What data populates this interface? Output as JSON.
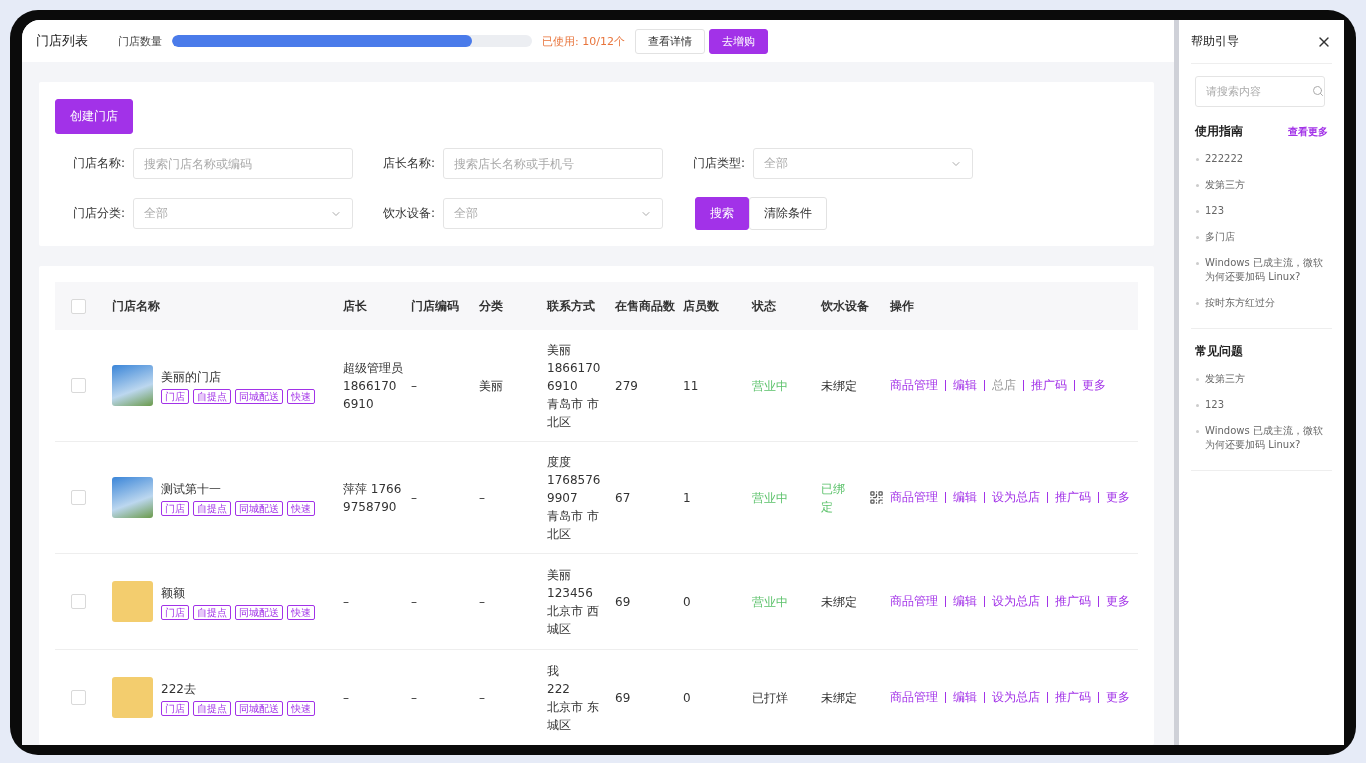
{
  "header": {
    "title": "门店列表",
    "quota_label": "门店数量",
    "quota": {
      "level": 0.833
    },
    "quota_text": "已使用: 10/12个",
    "buttons": [
      {
        "label": "查看详情",
        "kind": "default"
      },
      {
        "label": "去增购",
        "kind": "primary"
      }
    ]
  },
  "create_button": "创建门店",
  "filters": [
    {
      "label": "门店名称:",
      "kind": "input",
      "placeholder": "搜索门店名称或编码"
    },
    {
      "label": "店长名称:",
      "kind": "input",
      "placeholder": "搜索店长名称或手机号"
    },
    {
      "label": "门店类型:",
      "kind": "select",
      "value": "全部"
    },
    {
      "label": "门店分类:",
      "kind": "select",
      "value": "全部"
    },
    {
      "label": "饮水设备:",
      "kind": "select",
      "value": "全部"
    }
  ],
  "filter_buttons": [
    {
      "label": "搜索",
      "kind": "primary"
    },
    {
      "label": "清除条件",
      "kind": "default"
    }
  ],
  "table": {
    "columns": [
      "门店名称",
      "店长",
      "门店编码",
      "分类",
      "联系方式",
      "在售商品数",
      "店员数",
      "状态",
      "饮水设备",
      "操作"
    ],
    "select_all": false,
    "rows": [
      {
        "selected": false,
        "kind": "photo",
        "name": "美丽的门店",
        "tags": [
          "门店",
          "自提点",
          "同城配送",
          "快速"
        ],
        "manager": "超级管理员 18661706910",
        "code": "–",
        "category": "美丽",
        "contact": [
          "美丽",
          "18661706910",
          "青岛市 市北区"
        ],
        "goods": "279",
        "staff": "11",
        "status": {
          "text": "营业中",
          "kind": "open"
        },
        "device": {
          "text": "未绑定",
          "bound": false
        },
        "actions": [
          {
            "label": "商品管理",
            "disabled": false
          },
          {
            "label": "编辑",
            "disabled": false
          },
          {
            "label": "总店",
            "disabled": true
          },
          {
            "label": "推广码",
            "disabled": false
          },
          {
            "label": "更多",
            "disabled": false
          }
        ]
      },
      {
        "selected": false,
        "kind": "photo",
        "name": "测试第十一",
        "tags": [
          "门店",
          "自提点",
          "同城配送",
          "快速"
        ],
        "manager": "萍萍 17669758790",
        "code": "–",
        "category": "–",
        "contact": [
          "度度",
          "17685769907",
          "青岛市 市北区"
        ],
        "goods": "67",
        "staff": "1",
        "status": {
          "text": "营业中",
          "kind": "open"
        },
        "device": {
          "text": "已绑定",
          "bound": true
        },
        "actions": [
          {
            "label": "商品管理",
            "disabled": false
          },
          {
            "label": "编辑",
            "disabled": false
          },
          {
            "label": "设为总店",
            "disabled": false
          },
          {
            "label": "推广码",
            "disabled": false
          },
          {
            "label": "更多",
            "disabled": false
          }
        ]
      },
      {
        "selected": false,
        "kind": "placeholder",
        "name": "额额",
        "tags": [
          "门店",
          "自提点",
          "同城配送",
          "快速"
        ],
        "manager": "–",
        "code": "–",
        "category": "–",
        "contact": [
          "美丽",
          "123456",
          "北京市 西城区"
        ],
        "goods": "69",
        "staff": "0",
        "status": {
          "text": "营业中",
          "kind": "open"
        },
        "device": {
          "text": "未绑定",
          "bound": false
        },
        "actions": [
          {
            "label": "商品管理",
            "disabled": false
          },
          {
            "label": "编辑",
            "disabled": false
          },
          {
            "label": "设为总店",
            "disabled": false
          },
          {
            "label": "推广码",
            "disabled": false
          },
          {
            "label": "更多",
            "disabled": false
          }
        ]
      },
      {
        "selected": false,
        "kind": "placeholder",
        "name": "222去",
        "tags": [
          "门店",
          "自提点",
          "同城配送",
          "快速"
        ],
        "manager": "–",
        "code": "–",
        "category": "–",
        "contact": [
          "我",
          "222",
          "北京市 东城区"
        ],
        "goods": "69",
        "staff": "0",
        "status": {
          "text": "已打烊",
          "kind": "closed"
        },
        "device": {
          "text": "未绑定",
          "bound": false
        },
        "actions": [
          {
            "label": "商品管理",
            "disabled": false
          },
          {
            "label": "编辑",
            "disabled": false
          },
          {
            "label": "设为总店",
            "disabled": false
          },
          {
            "label": "推广码",
            "disabled": false
          },
          {
            "label": "更多",
            "disabled": false
          }
        ]
      }
    ]
  },
  "help": {
    "title": "帮助引导",
    "search_placeholder": "请搜索内容",
    "sections": [
      {
        "title": "使用指南",
        "more": "查看更多",
        "items": [
          "222222",
          "发第三方",
          "123",
          "多门店",
          "Windows 已成主流，微软为何还要加码 Linux?",
          "按时东方红过分"
        ]
      },
      {
        "title": "常见问题",
        "items": [
          "发第三方",
          "123",
          "Windows 已成主流，微软为何还要加码 Linux?"
        ]
      }
    ]
  }
}
